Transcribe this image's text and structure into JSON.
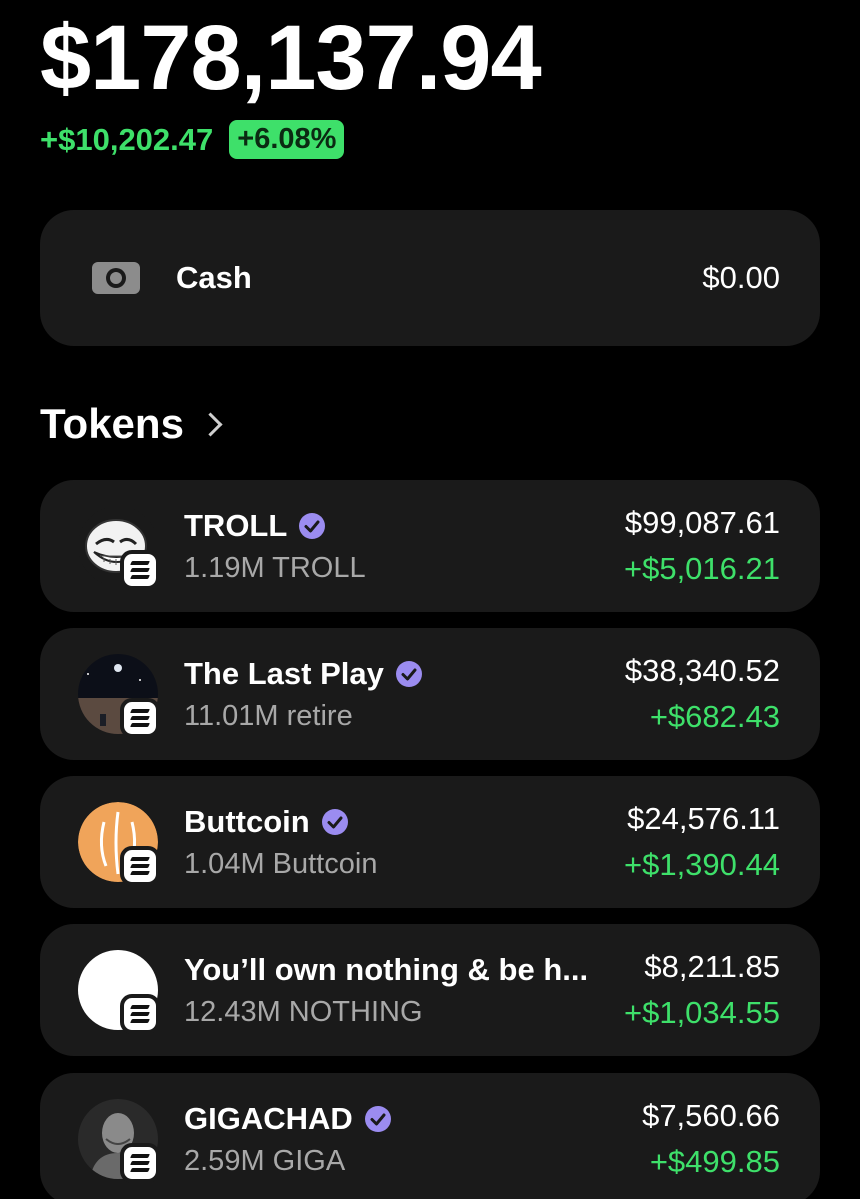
{
  "portfolio": {
    "balance": "$178,137.94",
    "change_amount": "+$10,202.47",
    "change_pct": "+6.08%"
  },
  "cash": {
    "icon": "cash-icon",
    "label": "Cash",
    "value": "$0.00"
  },
  "tokens_section": {
    "title": "Tokens"
  },
  "tokens": [
    {
      "name": "TROLL",
      "amount": "1.19M TROLL",
      "value": "$99,087.61",
      "change": "+$5,016.21",
      "verified": true
    },
    {
      "name": "The Last Play",
      "amount": "11.01M retire",
      "value": "$38,340.52",
      "change": "+$682.43",
      "verified": true
    },
    {
      "name": "Buttcoin",
      "amount": "1.04M Buttcoin",
      "value": "$24,576.11",
      "change": "+$1,390.44",
      "verified": true
    },
    {
      "name": "You’ll own nothing & be h...",
      "amount": "12.43M NOTHING",
      "value": "$8,211.85",
      "change": "+$1,034.55",
      "verified": false
    },
    {
      "name": "GIGACHAD",
      "amount": "2.59M GIGA",
      "value": "$7,560.66",
      "change": "+$499.85",
      "verified": true
    }
  ],
  "colors": {
    "positive": "#3ee06a",
    "verified_badge": "#9b8cf0",
    "card_bg": "#1a1a1a"
  }
}
